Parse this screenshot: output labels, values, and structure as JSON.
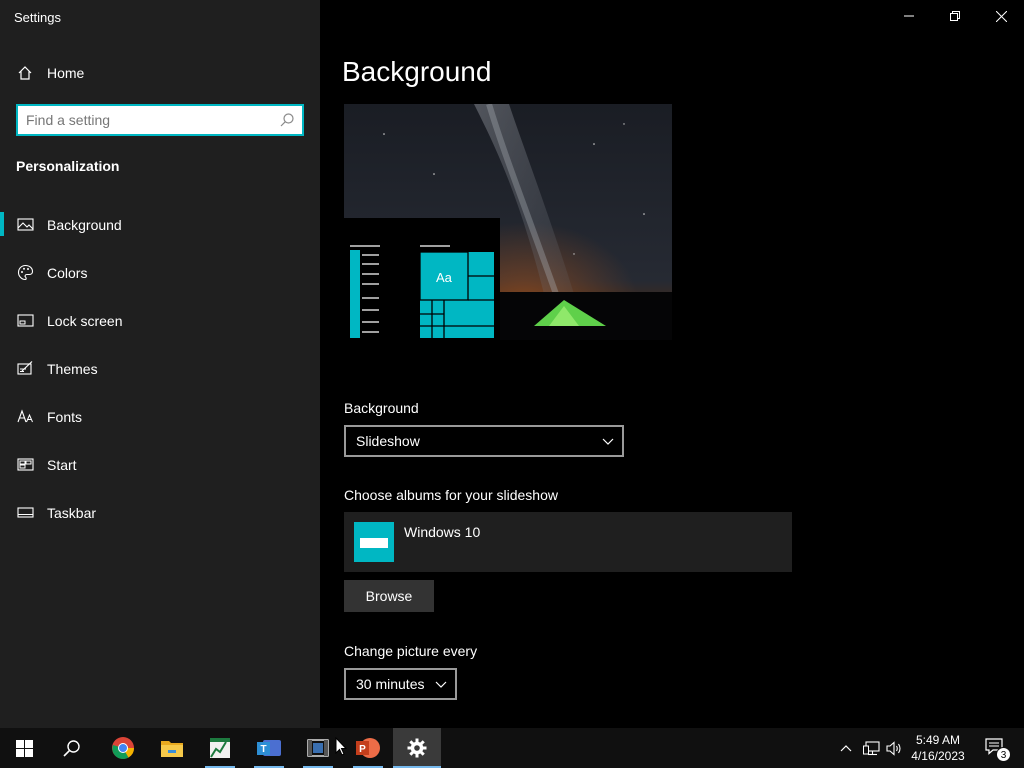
{
  "window": {
    "title": "Settings"
  },
  "sidebar": {
    "home_label": "Home",
    "search_placeholder": "Find a setting",
    "section_title": "Personalization",
    "items": [
      {
        "label": "Background",
        "icon": "picture-icon",
        "active": true
      },
      {
        "label": "Colors",
        "icon": "palette-icon",
        "active": false
      },
      {
        "label": "Lock screen",
        "icon": "lock-screen-icon",
        "active": false
      },
      {
        "label": "Themes",
        "icon": "themes-icon",
        "active": false
      },
      {
        "label": "Fonts",
        "icon": "fonts-icon",
        "active": false
      },
      {
        "label": "Start",
        "icon": "start-icon",
        "active": false
      },
      {
        "label": "Taskbar",
        "icon": "taskbar-icon",
        "active": false
      }
    ]
  },
  "main": {
    "title": "Background",
    "preview_tile_text": "Aa",
    "background_label": "Background",
    "background_value": "Slideshow",
    "albums_label": "Choose albums for your slideshow",
    "album_name": "Windows 10",
    "browse_label": "Browse",
    "interval_label": "Change picture every",
    "interval_value": "30 minutes"
  },
  "colors": {
    "accent": "#00b7c3",
    "sidebar_bg": "#1f1f1f",
    "content_bg": "#000000",
    "taskbar_bg": "#101010"
  },
  "taskbar": {
    "apps": [
      "start-icon",
      "search-icon",
      "chrome-icon",
      "file-explorer-icon",
      "excel-icon",
      "teams-icon",
      "video-editor-icon",
      "powerpoint-icon",
      "settings-gear-icon"
    ],
    "clock_time": "5:49 AM",
    "clock_date": "4/16/2023",
    "notification_count": "3"
  }
}
